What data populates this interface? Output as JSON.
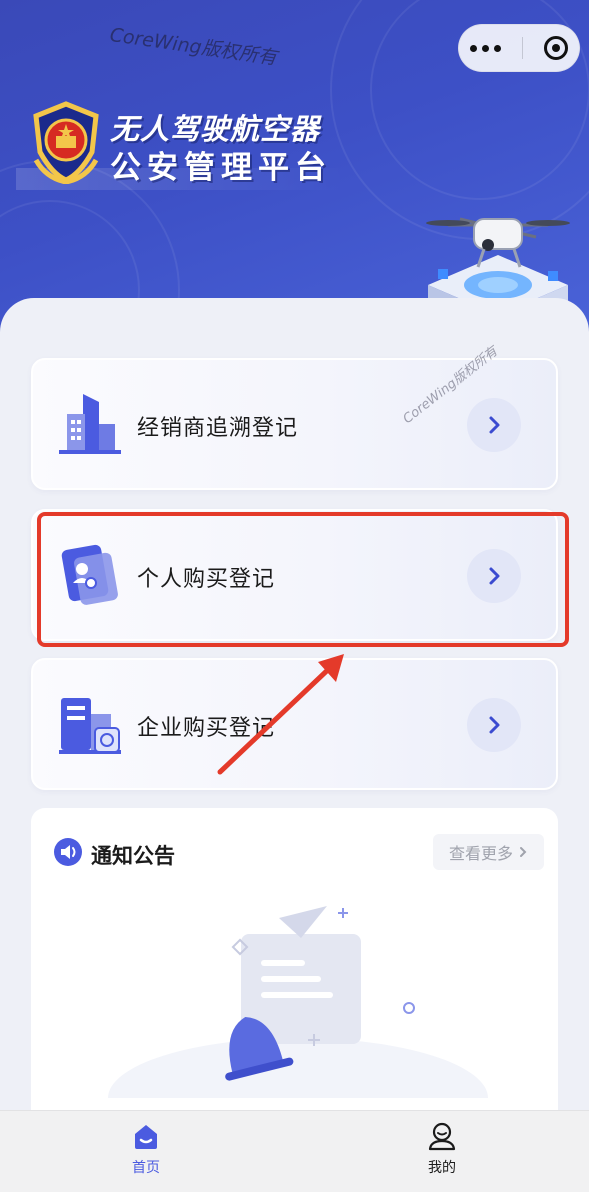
{
  "header": {
    "watermark": "CoreWing版权所有",
    "title_line1": "无人驾驶航空器",
    "title_line2": "公安管理平台",
    "menu_icon": "more-dots-icon",
    "close_icon": "target-circle-icon"
  },
  "cards": [
    {
      "label": "经销商追溯登记",
      "icon": "building-icon"
    },
    {
      "label": "个人购买登记",
      "icon": "id-card-icon"
    },
    {
      "label": "企业购买登记",
      "icon": "enterprise-building-icon"
    }
  ],
  "overlay_watermark": "CoreWing版权所有",
  "notice": {
    "title": "通知公告",
    "more_label": "查看更多",
    "icon": "speaker-icon",
    "empty_icon": "empty-bell-illustration"
  },
  "tabs": [
    {
      "label": "首页",
      "icon": "home-icon",
      "active": true
    },
    {
      "label": "我的",
      "icon": "user-icon",
      "active": false
    }
  ],
  "colors": {
    "header_blue": "#3d50c6",
    "accent": "#4b5be0",
    "highlight_red": "#e43a2a"
  }
}
